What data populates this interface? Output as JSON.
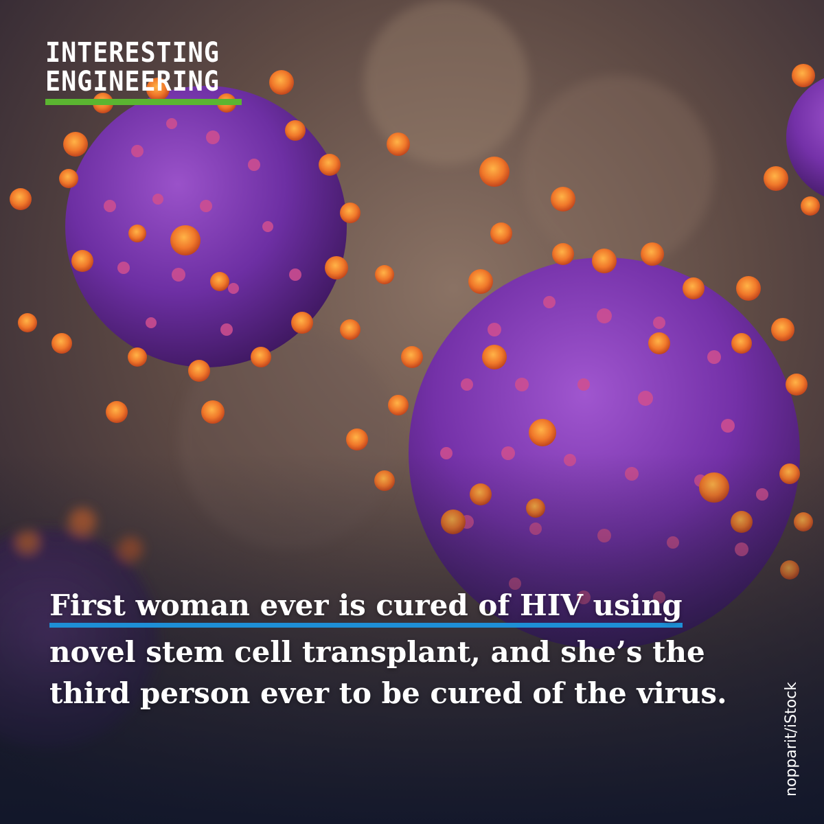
{
  "brand": {
    "line1": "INTERESTING",
    "line2": "ENGINEERING",
    "accent_color": "#5bb531"
  },
  "headline": {
    "line1": "First woman ever is cured of HIV using",
    "line2": "novel stem cell transplant, and she’s the",
    "line3": "third person ever to be cured of the virus.",
    "underline_color": "#1e8fd6"
  },
  "photo_credit": "nopparit/iStock"
}
